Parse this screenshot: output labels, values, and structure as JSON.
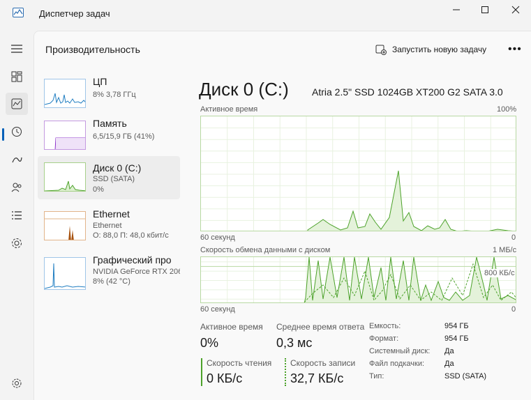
{
  "window": {
    "title": "Диспетчер задач"
  },
  "header": {
    "page_title": "Производительность",
    "run_task_label": "Запустить новую задачу",
    "more_label": "•••"
  },
  "devices": [
    {
      "name": "ЦП",
      "sub1": "8% 3,78 ГГц",
      "sub2": ""
    },
    {
      "name": "Память",
      "sub1": "6,5/15,9 ГБ (41%)",
      "sub2": ""
    },
    {
      "name": "Диск 0 (C:)",
      "sub1": "SSD (SATA)",
      "sub2": "0%"
    },
    {
      "name": "Ethernet",
      "sub1": "Ethernet",
      "sub2": "О: 88,0 П: 48,0 кбит/с"
    },
    {
      "name": "Графический про",
      "sub1": "NVIDIA GeForce RTX 206",
      "sub2": "8% (42 °C)"
    }
  ],
  "detail": {
    "title": "Диск 0 (C:)",
    "model": "Atria 2.5\" SSD 1024GB XT200 G2 SATA 3.0",
    "graph1": {
      "label": "Активное время",
      "max": "100%",
      "xlabel": "60 секунд",
      "min": "0"
    },
    "graph2": {
      "label": "Скорость обмена данными с диском",
      "max": "1 МБ/с",
      "mark": "800 КБ/с",
      "xlabel": "60 секунд",
      "min": "0"
    },
    "stats": {
      "active_time_label": "Активное время",
      "active_time_value": "0%",
      "avg_response_label": "Среднее время ответа",
      "avg_response_value": "0,3 мс",
      "read_label": "Скорость чтения",
      "read_value": "0 КБ/с",
      "write_label": "Скорость записи",
      "write_value": "32,7 КБ/с"
    },
    "props": [
      {
        "key": "Емкость:",
        "value": "954 ГБ"
      },
      {
        "key": "Формат:",
        "value": "954 ГБ"
      },
      {
        "key": "Системный диск:",
        "value": "Да"
      },
      {
        "key": "Файл подкачки:",
        "value": "Да"
      },
      {
        "key": "Тип:",
        "value": "SSD (SATA)"
      }
    ]
  },
  "colors": {
    "accent": "#005fb8",
    "disk": "#4ca22a",
    "memory": "#8b2fc9",
    "ethernet": "#a7520f",
    "cpu": "#1f7dc1"
  }
}
